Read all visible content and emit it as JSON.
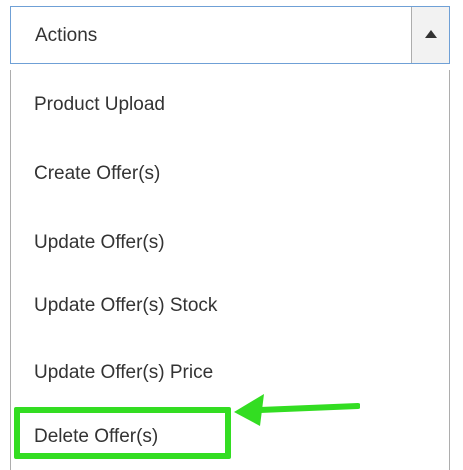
{
  "select": {
    "label": "Actions",
    "toggle_icon": "caret-up-icon"
  },
  "menu": {
    "items": [
      {
        "label": "Product Upload"
      },
      {
        "label": "Create Offer(s)"
      },
      {
        "label": "Update Offer(s)"
      },
      {
        "label": "Update Offer(s) Stock"
      },
      {
        "label": "Update Offer(s) Price"
      },
      {
        "label": "Delete Offer(s)"
      }
    ]
  },
  "annotation": {
    "highlight_color": "#33dd22",
    "icon": "arrow-left-icon"
  }
}
